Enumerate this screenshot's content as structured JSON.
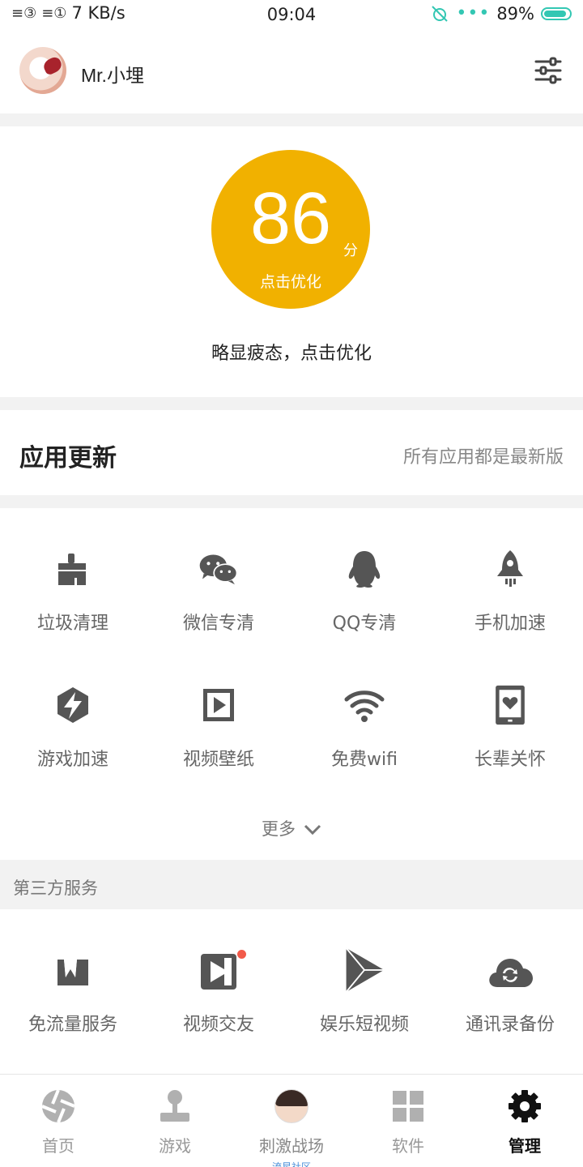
{
  "status_bar": {
    "net_speed": "7 KB/s",
    "time": "09:04",
    "battery": "89%",
    "battery_level": 0.89
  },
  "header": {
    "username": "Mr.小埋",
    "settings_icon": "sliders-icon"
  },
  "score": {
    "value": "86",
    "unit": "分",
    "action": "点击优化",
    "message": "略显疲态，点击优化",
    "color": "#f1b100"
  },
  "app_update": {
    "title": "应用更新",
    "status": "所有应用都是最新版"
  },
  "tools": [
    {
      "label": "垃圾清理",
      "icon": "broom-icon"
    },
    {
      "label": "微信专清",
      "icon": "wechat-icon"
    },
    {
      "label": "QQ专清",
      "icon": "qq-penguin-icon"
    },
    {
      "label": "手机加速",
      "icon": "rocket-icon"
    },
    {
      "label": "游戏加速",
      "icon": "lightning-shield-icon"
    },
    {
      "label": "视频壁纸",
      "icon": "video-frame-icon"
    },
    {
      "label": "免费wifi",
      "icon": "wifi-icon"
    },
    {
      "label": "长辈关怀",
      "icon": "phone-heart-icon"
    }
  ],
  "more_label": "更多",
  "third_party": {
    "title": "第三方服务",
    "items": [
      {
        "label": "免流量服务",
        "icon": "crown-w-icon"
      },
      {
        "label": "视频交友",
        "icon": "video-play-icon",
        "badge": true
      },
      {
        "label": "娱乐短视频",
        "icon": "play-triangle-icon"
      },
      {
        "label": "通讯录备份",
        "icon": "cloud-sync-icon"
      }
    ]
  },
  "bottom_nav": [
    {
      "label": "首页",
      "icon": "home-aperture-icon",
      "active": false
    },
    {
      "label": "游戏",
      "icon": "joystick-icon",
      "active": false
    },
    {
      "label": "刺激战场",
      "sub": "流星社区",
      "icon": "game-avatar-icon",
      "active": false
    },
    {
      "label": "软件",
      "icon": "apps-grid-icon",
      "active": false
    },
    {
      "label": "管理",
      "icon": "gear-icon",
      "active": true
    }
  ]
}
